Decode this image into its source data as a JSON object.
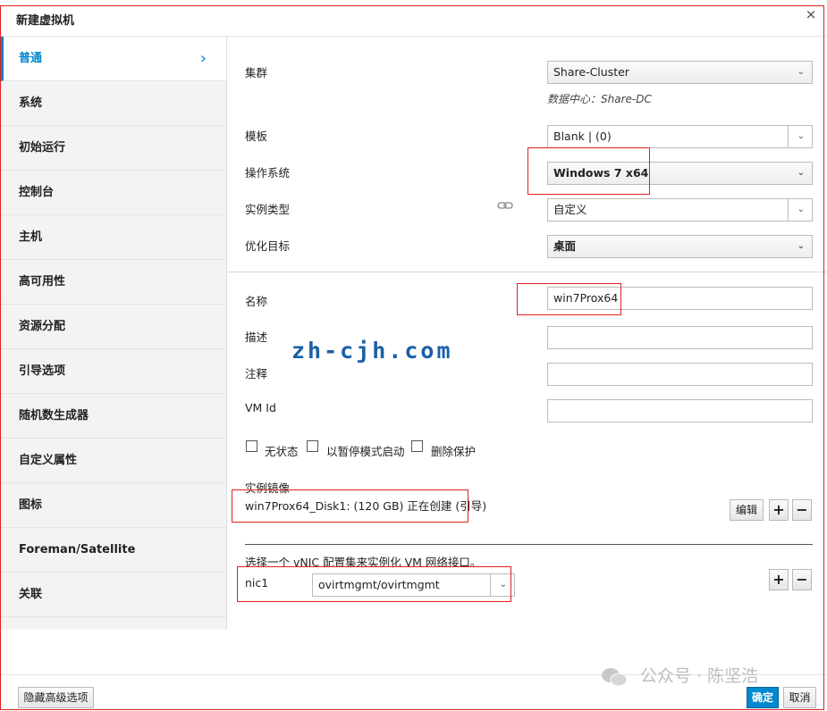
{
  "dialog": {
    "title": "新建虚拟机",
    "close_glyph": "×"
  },
  "sidebar": {
    "items": [
      {
        "label": "普通",
        "active": true
      },
      {
        "label": "系统"
      },
      {
        "label": "初始运行"
      },
      {
        "label": "控制台"
      },
      {
        "label": "主机"
      },
      {
        "label": "高可用性"
      },
      {
        "label": "资源分配"
      },
      {
        "label": "引导选项"
      },
      {
        "label": "随机数生成器"
      },
      {
        "label": "自定义属性"
      },
      {
        "label": "图标"
      },
      {
        "label": "Foreman/Satellite"
      },
      {
        "label": "关联"
      }
    ],
    "active_chevron": "›"
  },
  "form": {
    "cluster": {
      "label": "集群",
      "value": "Share-Cluster",
      "hint": "数据中心：Share-DC"
    },
    "template": {
      "label": "模板",
      "value": "Blank |  (0)"
    },
    "os": {
      "label": "操作系统",
      "value": "Windows 7 x64"
    },
    "instance_type": {
      "label": "实例类型",
      "value": "自定义"
    },
    "optimize": {
      "label": "优化目标",
      "value": "桌面"
    },
    "name": {
      "label": "名称",
      "value": "win7Prox64"
    },
    "description": {
      "label": "描述",
      "value": ""
    },
    "comment": {
      "label": "注释",
      "value": ""
    },
    "vm_id": {
      "label": "VM Id",
      "value": ""
    },
    "checkboxes": [
      {
        "label": "无状态",
        "checked": false
      },
      {
        "label": "以暂停模式启动",
        "checked": false
      },
      {
        "label": "删除保护",
        "checked": false
      }
    ],
    "instance_images": {
      "label": "实例镜像",
      "disk": "win7Prox64_Disk1: (120 GB) 正在创建 (引导)",
      "edit_label": "编辑",
      "plus": "+",
      "minus": "−"
    },
    "vnic": {
      "instruction": "选择一个 vNIC 配置集来实例化 VM 网络接口。",
      "nic_label": "nic1",
      "nic_value": "ovirtmgmt/ovirtmgmt",
      "plus": "+",
      "minus": "−"
    }
  },
  "footer": {
    "advanced_label": "隐藏高级选项",
    "ok_label": "确定",
    "cancel_label": "取消"
  },
  "overlay": {
    "watermark": "zh-cjh.com",
    "wechat_label": "公众号 · 陈坚浩"
  },
  "colors": {
    "accent": "#0088ce",
    "annotation_red": "#e02020"
  },
  "icons": {
    "caret": "⌄",
    "link": "chain-link-icon"
  }
}
